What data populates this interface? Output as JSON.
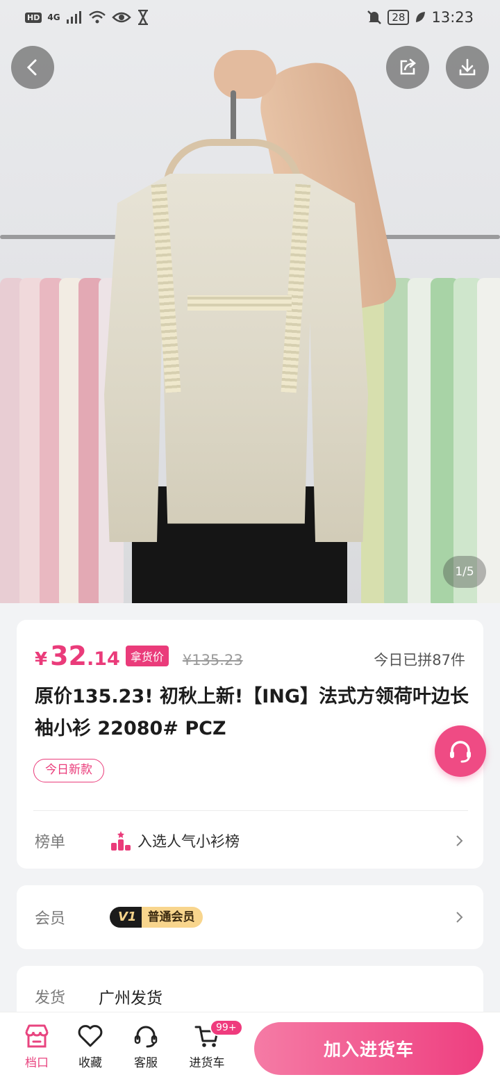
{
  "status_bar": {
    "left_tags": [
      "HD",
      "4G"
    ],
    "battery": "28",
    "time": "13:23"
  },
  "gallery": {
    "page_indicator": "1/5"
  },
  "product": {
    "currency": "¥",
    "price_integer": "32",
    "price_decimal": ".14",
    "price_tag": "拿货价",
    "original_price": "¥135.23",
    "sold_today": "今日已拼87件",
    "title": "原价135.23! 初秋上新!【ING】法式方领荷叶边长袖小衫  22080#  PCZ",
    "new_badge": "今日新款"
  },
  "ranking": {
    "label": "榜单",
    "text": "入选人气小衫榜"
  },
  "membership": {
    "label": "会员",
    "level": "V1",
    "level_name": "普通会员"
  },
  "shipping": {
    "label": "发货",
    "value": "广州发货"
  },
  "bottom_nav": {
    "items": [
      {
        "label": "档口",
        "icon": "store-icon",
        "active": true
      },
      {
        "label": "收藏",
        "icon": "heart-icon",
        "active": false
      },
      {
        "label": "客服",
        "icon": "headset-icon",
        "active": false
      },
      {
        "label": "进货车",
        "icon": "cart-icon",
        "active": false
      }
    ],
    "cart_badge": "99+",
    "add_to_cart": "加入进货车"
  },
  "colors": {
    "accent": "#ea3b7a",
    "vip_gold": "#f8d58d"
  }
}
